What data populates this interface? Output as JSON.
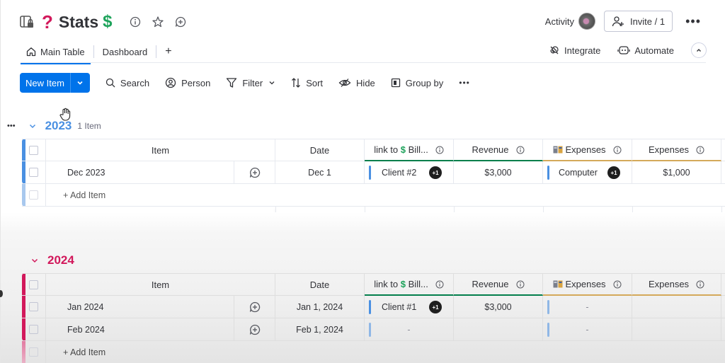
{
  "board": {
    "title": "Stats",
    "title_prefix_emoji": "?",
    "title_suffix_emoji": "$",
    "accent_question": "#d2185b",
    "accent_dollar": "#1ea35b"
  },
  "header_right": {
    "activity_label": "Activity",
    "invite_label": "Invite / 1",
    "more_label": "•••"
  },
  "tabs": {
    "items": [
      {
        "label": "Main Table",
        "icon": "home-icon",
        "active": true
      },
      {
        "label": "Dashboard",
        "active": false
      }
    ],
    "add_label": "+"
  },
  "tabs_right": {
    "integrate_label": "Integrate",
    "automate_label": "Automate"
  },
  "toolbar": {
    "new_item_label": "New Item",
    "search_label": "Search",
    "person_label": "Person",
    "filter_label": "Filter",
    "sort_label": "Sort",
    "hide_label": "Hide",
    "group_by_label": "Group by",
    "more_label": "•••",
    "primary_color": "#0073ea"
  },
  "columns": {
    "item": "Item",
    "date": "Date",
    "link_prefix": "link to",
    "link_emoji": "$",
    "link_suffix": "Bill...",
    "revenue": "Revenue",
    "expenses_linked": "Expenses",
    "expenses": "Expenses"
  },
  "groups": [
    {
      "title": "2023",
      "count_label": "1 Item",
      "color": "#4a90e2",
      "rows": [
        {
          "item": "Dec 2023",
          "date": "Dec 1",
          "link": "Client #2",
          "link_extra": "+1",
          "revenue": "$3,000",
          "expense_link": "Computer",
          "expense_link_extra": "+1",
          "expenses": "$1,000"
        }
      ],
      "add_item_label": "+ Add Item"
    },
    {
      "title": "2024",
      "count_label": "",
      "color": "#d2185b",
      "rows": [
        {
          "item": "Jan 2024",
          "date": "Jan 1, 2024",
          "link": "Client #1",
          "link_extra": "+1",
          "revenue": "$3,000",
          "expense_link": "-",
          "expenses": ""
        },
        {
          "item": "Feb 2024",
          "date": "Feb 1, 2024",
          "link": "-",
          "revenue": "",
          "expense_link": "-",
          "expenses": ""
        }
      ],
      "add_item_label": "+ Add Item"
    }
  ],
  "group_menu_label": "•••"
}
